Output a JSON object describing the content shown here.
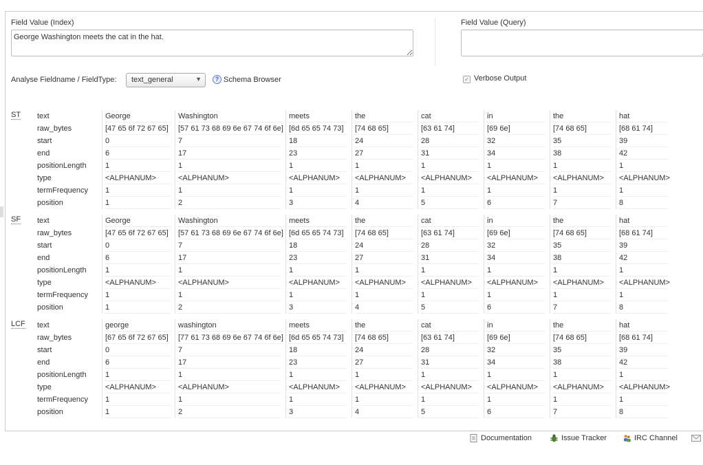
{
  "form": {
    "index_label": "Field Value (Index)",
    "index_value": "George Washington meets the cat in the hat.",
    "query_label": "Field Value (Query)",
    "query_value": "",
    "fieldtype_label": "Analyse Fieldname / FieldType:",
    "fieldtype_selected": "text_general",
    "schema_browser": "Schema Browser",
    "verbose_label": "Verbose Output",
    "verbose_checked": true
  },
  "row_labels": [
    "text",
    "raw_bytes",
    "start",
    "end",
    "positionLength",
    "type",
    "termFrequency",
    "position"
  ],
  "chains": [
    {
      "abbr": "ST",
      "tokens": [
        [
          "George",
          "[47 65 6f 72 67 65]",
          "0",
          "6",
          "1",
          "<ALPHANUM>",
          "1",
          "1"
        ],
        [
          "Washington",
          "[57 61 73 68 69 6e 67 74 6f 6e]",
          "7",
          "17",
          "1",
          "<ALPHANUM>",
          "1",
          "2"
        ],
        [
          "meets",
          "[6d 65 65 74 73]",
          "18",
          "23",
          "1",
          "<ALPHANUM>",
          "1",
          "3"
        ],
        [
          "the",
          "[74 68 65]",
          "24",
          "27",
          "1",
          "<ALPHANUM>",
          "1",
          "4"
        ],
        [
          "cat",
          "[63 61 74]",
          "28",
          "31",
          "1",
          "<ALPHANUM>",
          "1",
          "5"
        ],
        [
          "in",
          "[69 6e]",
          "32",
          "34",
          "1",
          "<ALPHANUM>",
          "1",
          "6"
        ],
        [
          "the",
          "[74 68 65]",
          "35",
          "38",
          "1",
          "<ALPHANUM>",
          "1",
          "7"
        ],
        [
          "hat",
          "[68 61 74]",
          "39",
          "42",
          "1",
          "<ALPHANUM>",
          "1",
          "8"
        ]
      ]
    },
    {
      "abbr": "SF",
      "tokens": [
        [
          "George",
          "[47 65 6f 72 67 65]",
          "0",
          "6",
          "1",
          "<ALPHANUM>",
          "1",
          "1"
        ],
        [
          "Washington",
          "[57 61 73 68 69 6e 67 74 6f 6e]",
          "7",
          "17",
          "1",
          "<ALPHANUM>",
          "1",
          "2"
        ],
        [
          "meets",
          "[6d 65 65 74 73]",
          "18",
          "23",
          "1",
          "<ALPHANUM>",
          "1",
          "3"
        ],
        [
          "the",
          "[74 68 65]",
          "24",
          "27",
          "1",
          "<ALPHANUM>",
          "1",
          "4"
        ],
        [
          "cat",
          "[63 61 74]",
          "28",
          "31",
          "1",
          "<ALPHANUM>",
          "1",
          "5"
        ],
        [
          "in",
          "[69 6e]",
          "32",
          "34",
          "1",
          "<ALPHANUM>",
          "1",
          "6"
        ],
        [
          "the",
          "[74 68 65]",
          "35",
          "38",
          "1",
          "<ALPHANUM>",
          "1",
          "7"
        ],
        [
          "hat",
          "[68 61 74]",
          "39",
          "42",
          "1",
          "<ALPHANUM>",
          "1",
          "8"
        ]
      ]
    },
    {
      "abbr": "LCF",
      "tokens": [
        [
          "george",
          "[67 65 6f 72 67 65]",
          "0",
          "6",
          "1",
          "<ALPHANUM>",
          "1",
          "1"
        ],
        [
          "washington",
          "[77 61 73 68 69 6e 67 74 6f 6e]",
          "7",
          "17",
          "1",
          "<ALPHANUM>",
          "1",
          "2"
        ],
        [
          "meets",
          "[6d 65 65 74 73]",
          "18",
          "23",
          "1",
          "<ALPHANUM>",
          "1",
          "3"
        ],
        [
          "the",
          "[74 68 65]",
          "24",
          "27",
          "1",
          "<ALPHANUM>",
          "1",
          "4"
        ],
        [
          "cat",
          "[63 61 74]",
          "28",
          "31",
          "1",
          "<ALPHANUM>",
          "1",
          "5"
        ],
        [
          "in",
          "[69 6e]",
          "32",
          "34",
          "1",
          "<ALPHANUM>",
          "1",
          "6"
        ],
        [
          "the",
          "[74 68 65]",
          "35",
          "38",
          "1",
          "<ALPHANUM>",
          "1",
          "7"
        ],
        [
          "hat",
          "[68 61 74]",
          "39",
          "42",
          "1",
          "<ALPHANUM>",
          "1",
          "8"
        ]
      ]
    }
  ],
  "footer": {
    "documentation": "Documentation",
    "issue_tracker": "Issue Tracker",
    "irc_channel": "IRC Channel",
    "icons": [
      "document-icon",
      "bug-icon",
      "people-icon",
      "mail-icon"
    ]
  }
}
